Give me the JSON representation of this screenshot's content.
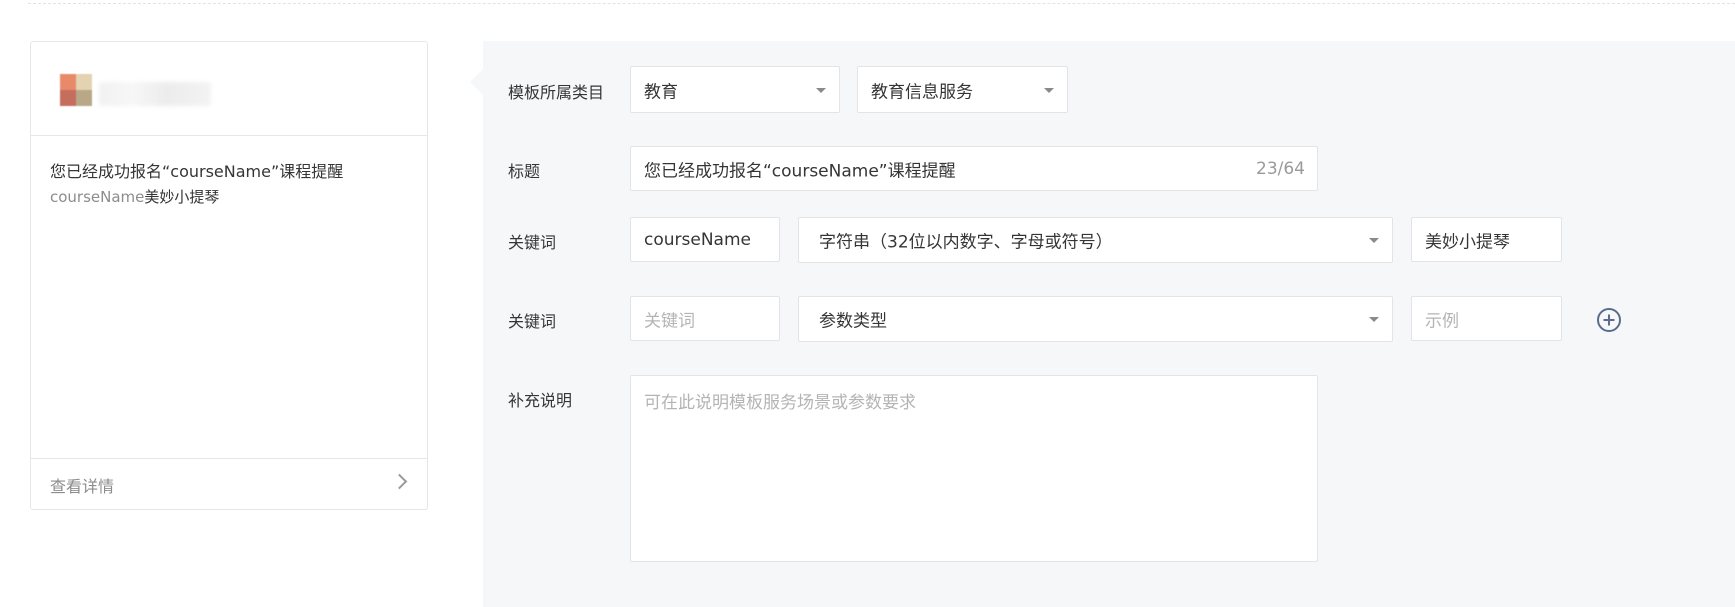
{
  "preview": {
    "title": "您已经成功报名“courseName”课程提醒",
    "body_keyword": "courseName",
    "body_value": "美妙小提琴",
    "footer_label": "查看详情",
    "avatar_colors": [
      "#e88a6a",
      "#e3d3b0",
      "#c56e5e",
      "#b9a887"
    ]
  },
  "form": {
    "category": {
      "label": "模板所属类目",
      "primary": "教育",
      "secondary": "教育信息服务"
    },
    "title_field": {
      "label": "标题",
      "value": "您已经成功报名“courseName”课程提醒",
      "counter": "23/64"
    },
    "keyword_rows": [
      {
        "label": "关键词",
        "name_value": "courseName",
        "type_value": "字符串（32位以内数字、字母或符号）",
        "example_value": "美妙小提琴"
      },
      {
        "label": "关键词",
        "name_placeholder": "关键词",
        "type_value": "参数类型",
        "example_placeholder": "示例"
      }
    ],
    "notes": {
      "label": "补充说明",
      "placeholder": "可在此说明模板服务场景或参数要求"
    }
  },
  "colors": {
    "panel_bg": "#f6f7f9",
    "border": "#e2e4e8",
    "add_icon": "#5b6b8c"
  }
}
